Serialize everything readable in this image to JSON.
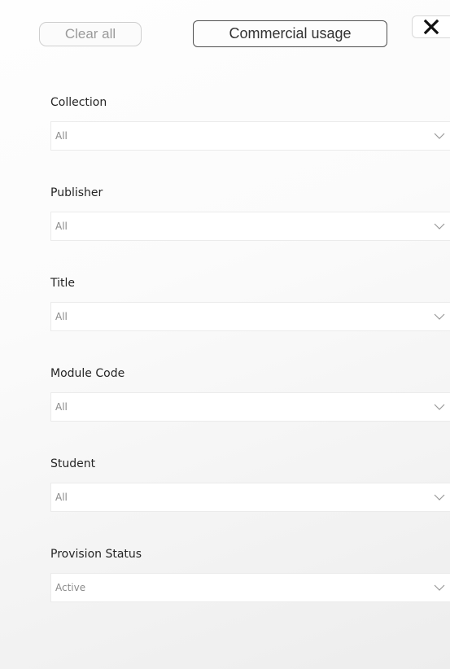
{
  "toolbar": {
    "clear_all_label": "Clear all",
    "commercial_usage_label": "Commercial usage",
    "close_icon": "close-icon"
  },
  "filters": [
    {
      "label": "Collection",
      "value": "All"
    },
    {
      "label": "Publisher",
      "value": "All"
    },
    {
      "label": "Title",
      "value": "All"
    },
    {
      "label": "Module Code",
      "value": "All"
    },
    {
      "label": "Student",
      "value": "All"
    },
    {
      "label": "Provision Status",
      "value": "Active"
    }
  ],
  "colors": {
    "chevron": "#9a9a9a",
    "close": "#111111"
  }
}
